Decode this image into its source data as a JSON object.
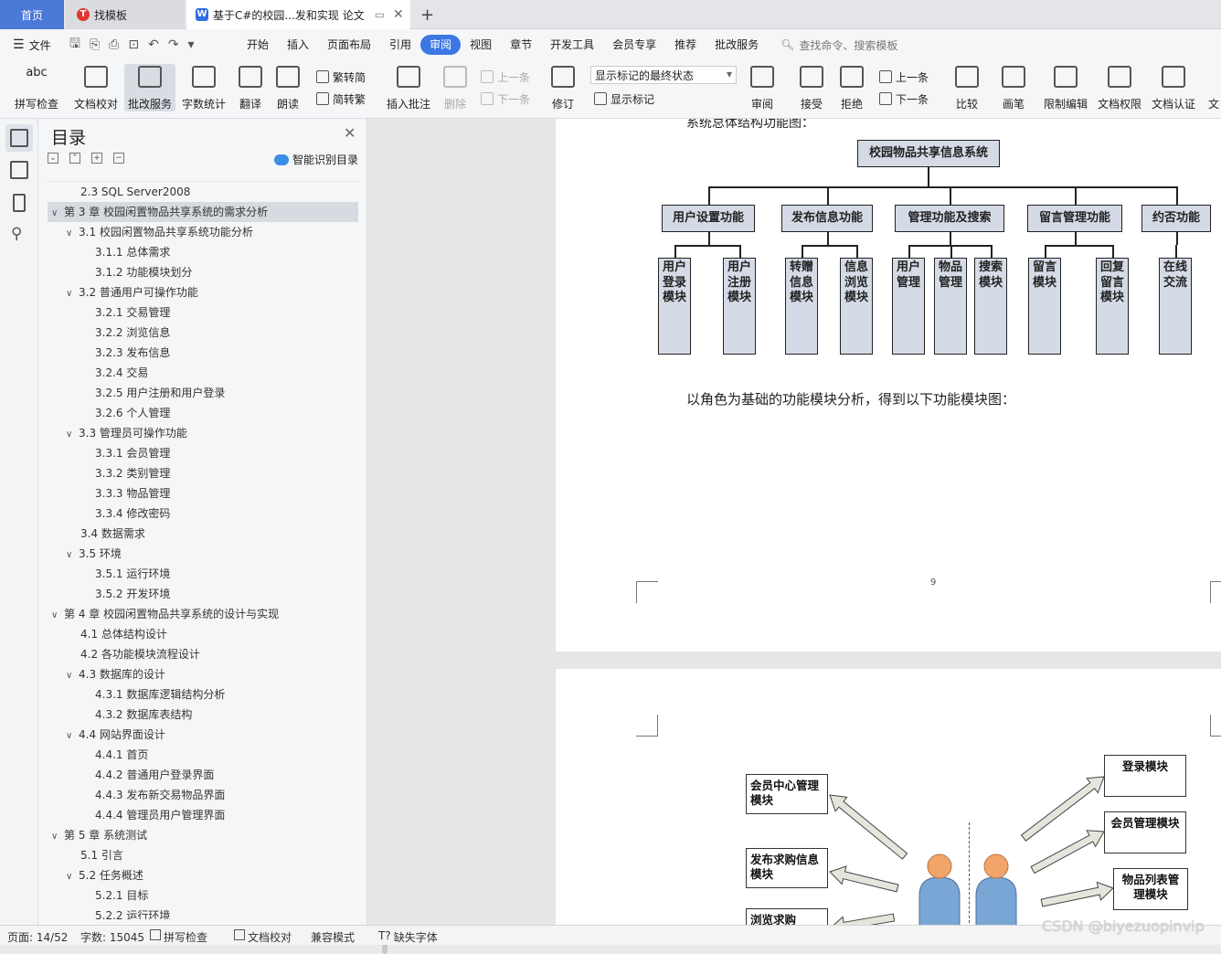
{
  "tabs": {
    "home": "首页",
    "template": "找模板",
    "document": "基于C#的校园...发和实现 论文",
    "add": "+"
  },
  "menu": {
    "file": "文件",
    "items": [
      "开始",
      "插入",
      "页面布局",
      "引用",
      "审阅",
      "视图",
      "章节",
      "开发工具",
      "会员专享",
      "推荐",
      "批改服务"
    ],
    "active": "审阅",
    "search": "查找命令、搜索模板"
  },
  "ribbon": {
    "spell": "拼写检查",
    "proof": "文档校对",
    "review_service": "批改服务",
    "word_count": "字数统计",
    "translate": "翻译",
    "read_aloud": "朗读",
    "trad": "繁转简",
    "simp": "简转繁",
    "insert_comment": "插入批注",
    "delete": "删除",
    "prev": "上一条",
    "next": "下一条",
    "track": "修订",
    "markup_state": "显示标记的最终状态",
    "show_markup": "显示标记",
    "review": "审阅",
    "accept": "接受",
    "reject": "拒绝",
    "prev2": "上一条",
    "next2": "下一条",
    "compare": "比较",
    "ink": "画笔",
    "restrict": "限制编辑",
    "doc_rights": "文档权限",
    "doc_cert": "文档认证",
    "more": "文"
  },
  "toc": {
    "title": "目录",
    "smart": "智能识别目录",
    "items": [
      {
        "text": "2.3 SQL Server2008",
        "level": 2,
        "caret": ""
      },
      {
        "text": "第 3 章  校园闲置物品共享系统的需求分析",
        "level": 1,
        "caret": "v"
      },
      {
        "text": "3.1 校园闲置物品共享系统功能分析",
        "level": 2,
        "caret": "v"
      },
      {
        "text": "3.1.1 总体需求",
        "level": 3,
        "caret": ""
      },
      {
        "text": "3.1.2 功能模块划分",
        "level": 3,
        "caret": ""
      },
      {
        "text": "3.2 普通用户可操作功能",
        "level": 2,
        "caret": "v"
      },
      {
        "text": "3.2.1 交易管理",
        "level": 3,
        "caret": ""
      },
      {
        "text": "3.2.2 浏览信息",
        "level": 3,
        "caret": ""
      },
      {
        "text": "3.2.3 发布信息",
        "level": 3,
        "caret": ""
      },
      {
        "text": "3.2.4  交易",
        "level": 3,
        "caret": ""
      },
      {
        "text": "3.2.5 用户注册和用户登录",
        "level": 3,
        "caret": ""
      },
      {
        "text": "3.2.6 个人管理",
        "level": 3,
        "caret": ""
      },
      {
        "text": "3.3 管理员可操作功能",
        "level": 2,
        "caret": "v"
      },
      {
        "text": "3.3.1 会员管理",
        "level": 3,
        "caret": ""
      },
      {
        "text": "3.3.2 类别管理",
        "level": 3,
        "caret": ""
      },
      {
        "text": "3.3.3 物品管理",
        "level": 3,
        "caret": ""
      },
      {
        "text": "3.3.4  修改密码",
        "level": 3,
        "caret": ""
      },
      {
        "text": "3.4 数据需求",
        "level": 2,
        "caret": ""
      },
      {
        "text": "3.5 环境",
        "level": 2,
        "caret": "v"
      },
      {
        "text": "3.5.1 运行环境",
        "level": 3,
        "caret": ""
      },
      {
        "text": "3.5.2 开发环境",
        "level": 3,
        "caret": ""
      },
      {
        "text": "第 4 章  校园闲置物品共享系统的设计与实现",
        "level": 1,
        "caret": "v"
      },
      {
        "text": "4.1 总体结构设计",
        "level": 2,
        "caret": ""
      },
      {
        "text": "4.2 各功能模块流程设计",
        "level": 2,
        "caret": ""
      },
      {
        "text": "4.3 数据库的设计",
        "level": 2,
        "caret": "v"
      },
      {
        "text": "4.3.1 数据库逻辑结构分析",
        "level": 3,
        "caret": ""
      },
      {
        "text": "4.3.2 数据库表结构",
        "level": 3,
        "caret": ""
      },
      {
        "text": "4.4 网站界面设计",
        "level": 2,
        "caret": "v"
      },
      {
        "text": "4.4.1 首页",
        "level": 3,
        "caret": ""
      },
      {
        "text": "4.4.2 普通用户登录界面",
        "level": 3,
        "caret": ""
      },
      {
        "text": "4.4.3 发布新交易物品界面",
        "level": 3,
        "caret": ""
      },
      {
        "text": "4.4.4 管理员用户管理界面",
        "level": 3,
        "caret": ""
      },
      {
        "text": "第 5 章  系统测试",
        "level": 1,
        "caret": "v"
      },
      {
        "text": "5.1  引言",
        "level": 2,
        "caret": ""
      },
      {
        "text": "5.2  任务概述",
        "level": 2,
        "caret": "v"
      },
      {
        "text": "5.2.1  目标",
        "level": 3,
        "caret": ""
      },
      {
        "text": "5.2.2  运行环境",
        "level": 3,
        "caret": ""
      }
    ]
  },
  "doc": {
    "cutoff": "系统总体结构功能图：",
    "root": "校园物品共享信息系统",
    "groups": [
      "用户设置功能",
      "发布信息功能",
      "管理功能及搜索",
      "留言管理功能",
      "约否功能"
    ],
    "leaves": [
      "用户登录模块",
      "用户注册模块",
      "转赠信息模块",
      "信息浏览模块",
      "用户管理",
      "物品管理",
      "搜索模块",
      "留言模块",
      "回复留言模块",
      "在线交流"
    ],
    "para": "以角色为基础的功能模块分析，得到以下功能模块图：",
    "page_number": "9",
    "left_modules": [
      "会员中心管理模块",
      "发布求购信息模块",
      "浏览求购"
    ],
    "right_modules": [
      "登录模块",
      "会员管理模块",
      "物品列表管理模块"
    ]
  },
  "status": {
    "page": "页面: 14/52",
    "words": "字数: 15045",
    "spell": "拼写检查",
    "proof": "文档校对",
    "compat": "兼容模式",
    "missing_font": "缺失字体"
  },
  "watermark": "CSDN @biyezuopinvip"
}
